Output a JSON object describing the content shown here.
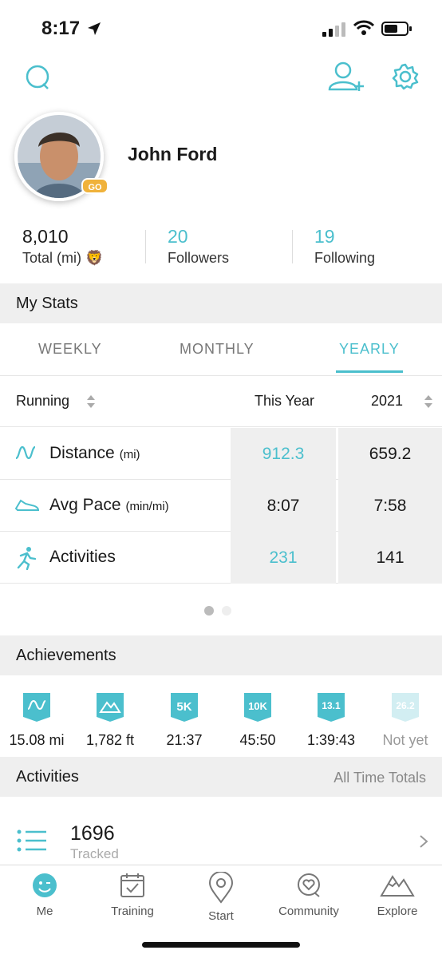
{
  "status": {
    "time": "8:17"
  },
  "profile": {
    "name": "John Ford",
    "badge": "GO"
  },
  "stats": [
    {
      "value": "8,010",
      "label": "Total (mi) 🦁"
    },
    {
      "value": "20",
      "label": "Followers"
    },
    {
      "value": "19",
      "label": "Following"
    }
  ],
  "my_stats": {
    "title": "My Stats",
    "tabs": [
      "WEEKLY",
      "MONTHLY",
      "YEARLY"
    ],
    "active_tab": "YEARLY",
    "sport": "Running",
    "col1": "This Year",
    "col2": "2021",
    "rows": [
      {
        "label": "Distance",
        "unit": "(mi)",
        "v1": "912.3",
        "v2": "659.2"
      },
      {
        "label": "Avg Pace",
        "unit": "(min/mi)",
        "v1": "8:07",
        "v2": "7:58"
      },
      {
        "label": "Activities",
        "unit": "",
        "v1": "231",
        "v2": "141"
      }
    ]
  },
  "achievements": {
    "title": "Achievements",
    "items": [
      {
        "badge": "",
        "label": "15.08 mi"
      },
      {
        "badge": "",
        "label": "1,782 ft"
      },
      {
        "badge": "5K",
        "label": "21:37"
      },
      {
        "badge": "10K",
        "label": "45:50"
      },
      {
        "badge": "13.1",
        "label": "1:39:43"
      },
      {
        "badge": "26.2",
        "label": "Not yet"
      }
    ]
  },
  "activities": {
    "title": "Activities",
    "right": "All Time Totals",
    "count": "1696",
    "count_label": "Tracked"
  },
  "tabbar": [
    {
      "label": "Me",
      "icon": "smiley-icon"
    },
    {
      "label": "Training",
      "icon": "calendar-check-icon"
    },
    {
      "label": "Start",
      "icon": "map-pin-icon"
    },
    {
      "label": "Community",
      "icon": "chat-heart-icon"
    },
    {
      "label": "Explore",
      "icon": "mountains-icon"
    }
  ],
  "colors": {
    "accent": "#4bbfcd",
    "badge": "#f0b23b",
    "section_bg": "#efefef"
  }
}
